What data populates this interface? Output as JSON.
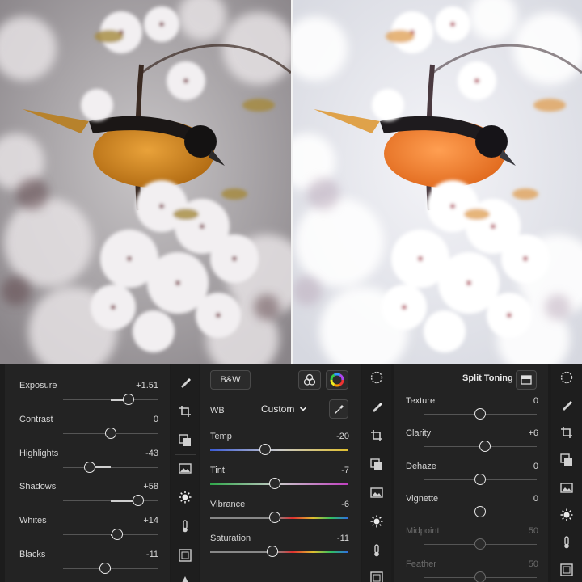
{
  "comparison": {
    "before_label": "",
    "after_label": ""
  },
  "panel_light": {
    "rows": [
      {
        "label": "Exposure",
        "value": "+1.51",
        "pos": 0.69
      },
      {
        "label": "Contrast",
        "value": "0",
        "pos": 0.5
      },
      {
        "label": "Highlights",
        "value": "-43",
        "pos": 0.28
      },
      {
        "label": "Shadows",
        "value": "+58",
        "pos": 0.79
      },
      {
        "label": "Whites",
        "value": "+14",
        "pos": 0.57
      },
      {
        "label": "Blacks",
        "value": "-11",
        "pos": 0.44
      }
    ]
  },
  "panel_color": {
    "bw_label": "B&W",
    "wb_label": "WB",
    "wb_value": "Custom",
    "rows": [
      {
        "label": "Temp",
        "value": "-20",
        "pos": 0.4,
        "track": "temp"
      },
      {
        "label": "Tint",
        "value": "-7",
        "pos": 0.47,
        "track": "tint"
      },
      {
        "label": "Vibrance",
        "value": "-6",
        "pos": 0.47,
        "track": "vib"
      },
      {
        "label": "Saturation",
        "value": "-11",
        "pos": 0.45,
        "track": "sat"
      }
    ]
  },
  "panel_effects": {
    "split_toning_label": "Split Toning",
    "rows": [
      {
        "label": "Texture",
        "value": "0",
        "pos": 0.5,
        "dim": false
      },
      {
        "label": "Clarity",
        "value": "+6",
        "pos": 0.54,
        "dim": false
      },
      {
        "label": "Dehaze",
        "value": "0",
        "pos": 0.5,
        "dim": false
      },
      {
        "label": "Vignette",
        "value": "0",
        "pos": 0.5,
        "dim": false
      },
      {
        "label": "Midpoint",
        "value": "50",
        "pos": 0.5,
        "dim": true
      },
      {
        "label": "Feather",
        "value": "50",
        "pos": 0.5,
        "dim": true
      }
    ]
  },
  "icons": {
    "rail": [
      "brush-icon",
      "crop-icon",
      "layers-icon",
      "image-adjust-icon",
      "sun-icon",
      "thermometer-icon",
      "vignette-frame-icon"
    ]
  }
}
